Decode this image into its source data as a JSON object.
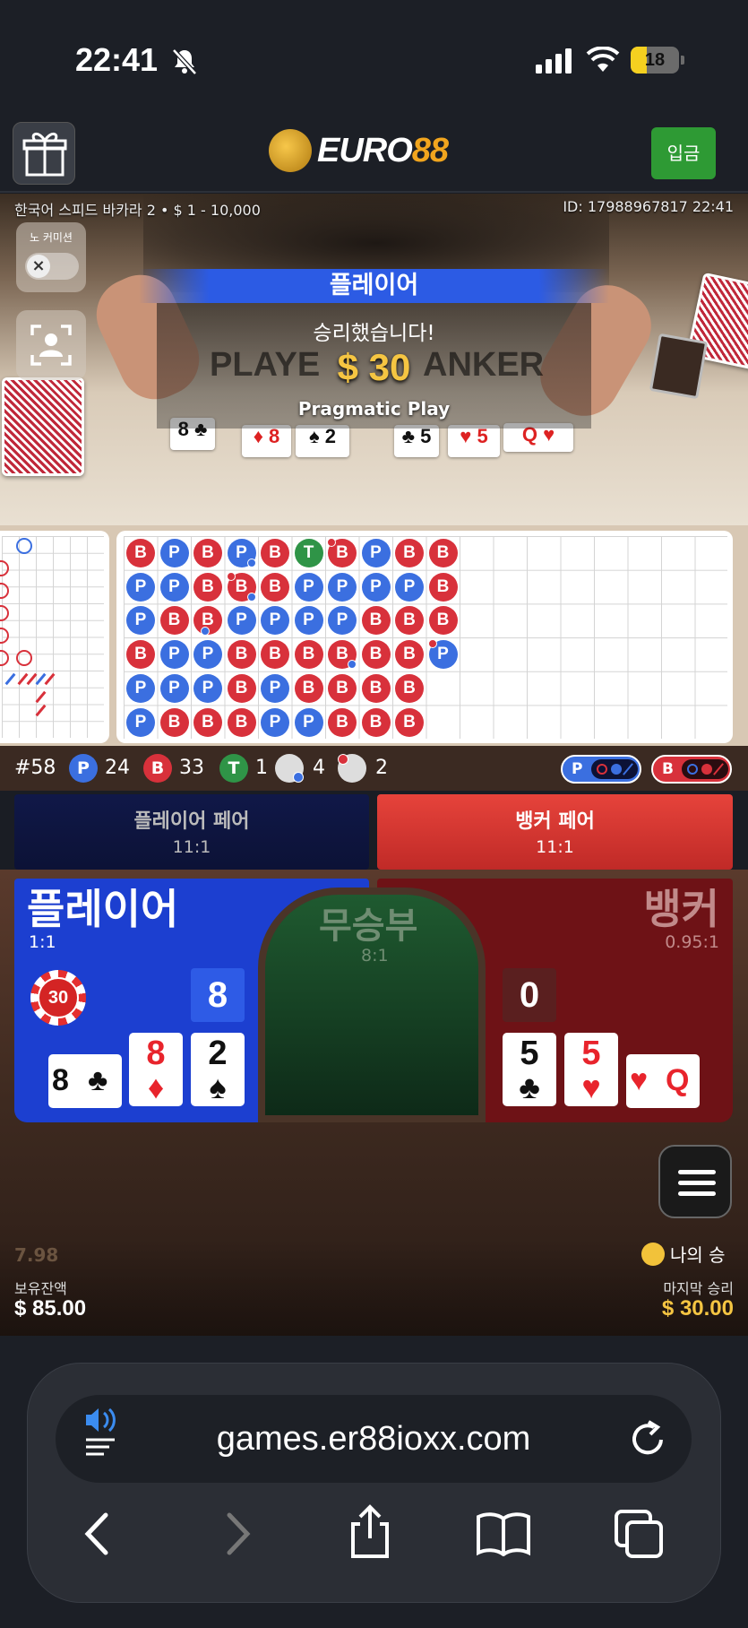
{
  "status_bar": {
    "time": "22:41",
    "battery": "18"
  },
  "header": {
    "logo_a": "EURO",
    "logo_b": "88",
    "deposit_label": "입금"
  },
  "video": {
    "table_info": "한국어 스피드 바카라 2 • $ 1 - 10,000",
    "round_id": "ID: 17988967817 22:41",
    "no_commission_label": "노 커미션",
    "win_banner": "플레이어",
    "win_message": "승리했습니다!",
    "win_amount": "$ 30",
    "ghost_left": "PLAYE",
    "ghost_right": "ANKER",
    "provider": "Pragmatic Play"
  },
  "stats": {
    "round": "#58",
    "player_label": "P",
    "player_count": "24",
    "banker_label": "B",
    "banker_count": "33",
    "tie_label": "T",
    "tie_count": "1",
    "player_pair_count": "4",
    "banker_pair_count": "2",
    "player_predict_label": "P",
    "banker_predict_label": "B"
  },
  "side_bets": {
    "player_pair": {
      "label": "플레이어 페어",
      "odds": "11:1"
    },
    "banker_pair": {
      "label": "뱅커 페어",
      "odds": "11:1"
    }
  },
  "main_bets": {
    "player": {
      "label": "플레이어",
      "odds": "1:1",
      "score": "8",
      "chip": "30",
      "cards": [
        {
          "rank": "8",
          "suit": "♣",
          "color": "black"
        },
        {
          "rank": "8",
          "suit": "♦",
          "color": "red"
        },
        {
          "rank": "2",
          "suit": "♠",
          "color": "black"
        }
      ]
    },
    "tie": {
      "label": "무승부",
      "odds": "8:1"
    },
    "banker": {
      "label": "뱅커",
      "odds": "0.95:1",
      "score": "0",
      "cards": [
        {
          "rank": "5",
          "suit": "♣",
          "color": "black"
        },
        {
          "rank": "5",
          "suit": "♥",
          "color": "red"
        },
        {
          "rank": "Q",
          "suit": "♥",
          "color": "red"
        }
      ]
    }
  },
  "balance": {
    "faded_value": "7.98",
    "my_win_label": "나의 승",
    "balance_label": "보유잔액",
    "balance_value": "$ 85.00",
    "last_win_label": "마지막 승리",
    "last_win_value": "$ 30.00"
  },
  "browser": {
    "url": "games.er88ioxx.com"
  },
  "colors": {
    "player_blue": "#3b6fe0",
    "banker_red": "#d8313b",
    "tie_green": "#2f9447",
    "deposit_green": "#2e9a34",
    "gold": "#f5c542"
  },
  "roadmap": {
    "bead_rows": [
      [
        "B",
        "P",
        "B",
        "P",
        "B",
        "T",
        "B",
        "P",
        "B",
        "B"
      ],
      [
        "P",
        "P",
        "B",
        "B",
        "B",
        "P",
        "P",
        "P",
        "P",
        "B"
      ],
      [
        "P",
        "B",
        "B",
        "P",
        "P",
        "P",
        "P",
        "B",
        "B",
        "B"
      ],
      [
        "B",
        "P",
        "P",
        "B",
        "B",
        "B",
        "B",
        "B",
        "B",
        "P"
      ],
      [
        "P",
        "P",
        "P",
        "B",
        "P",
        "B",
        "B",
        "B",
        "B",
        ""
      ],
      [
        "P",
        "B",
        "B",
        "B",
        "P",
        "P",
        "B",
        "B",
        "B",
        ""
      ]
    ]
  }
}
